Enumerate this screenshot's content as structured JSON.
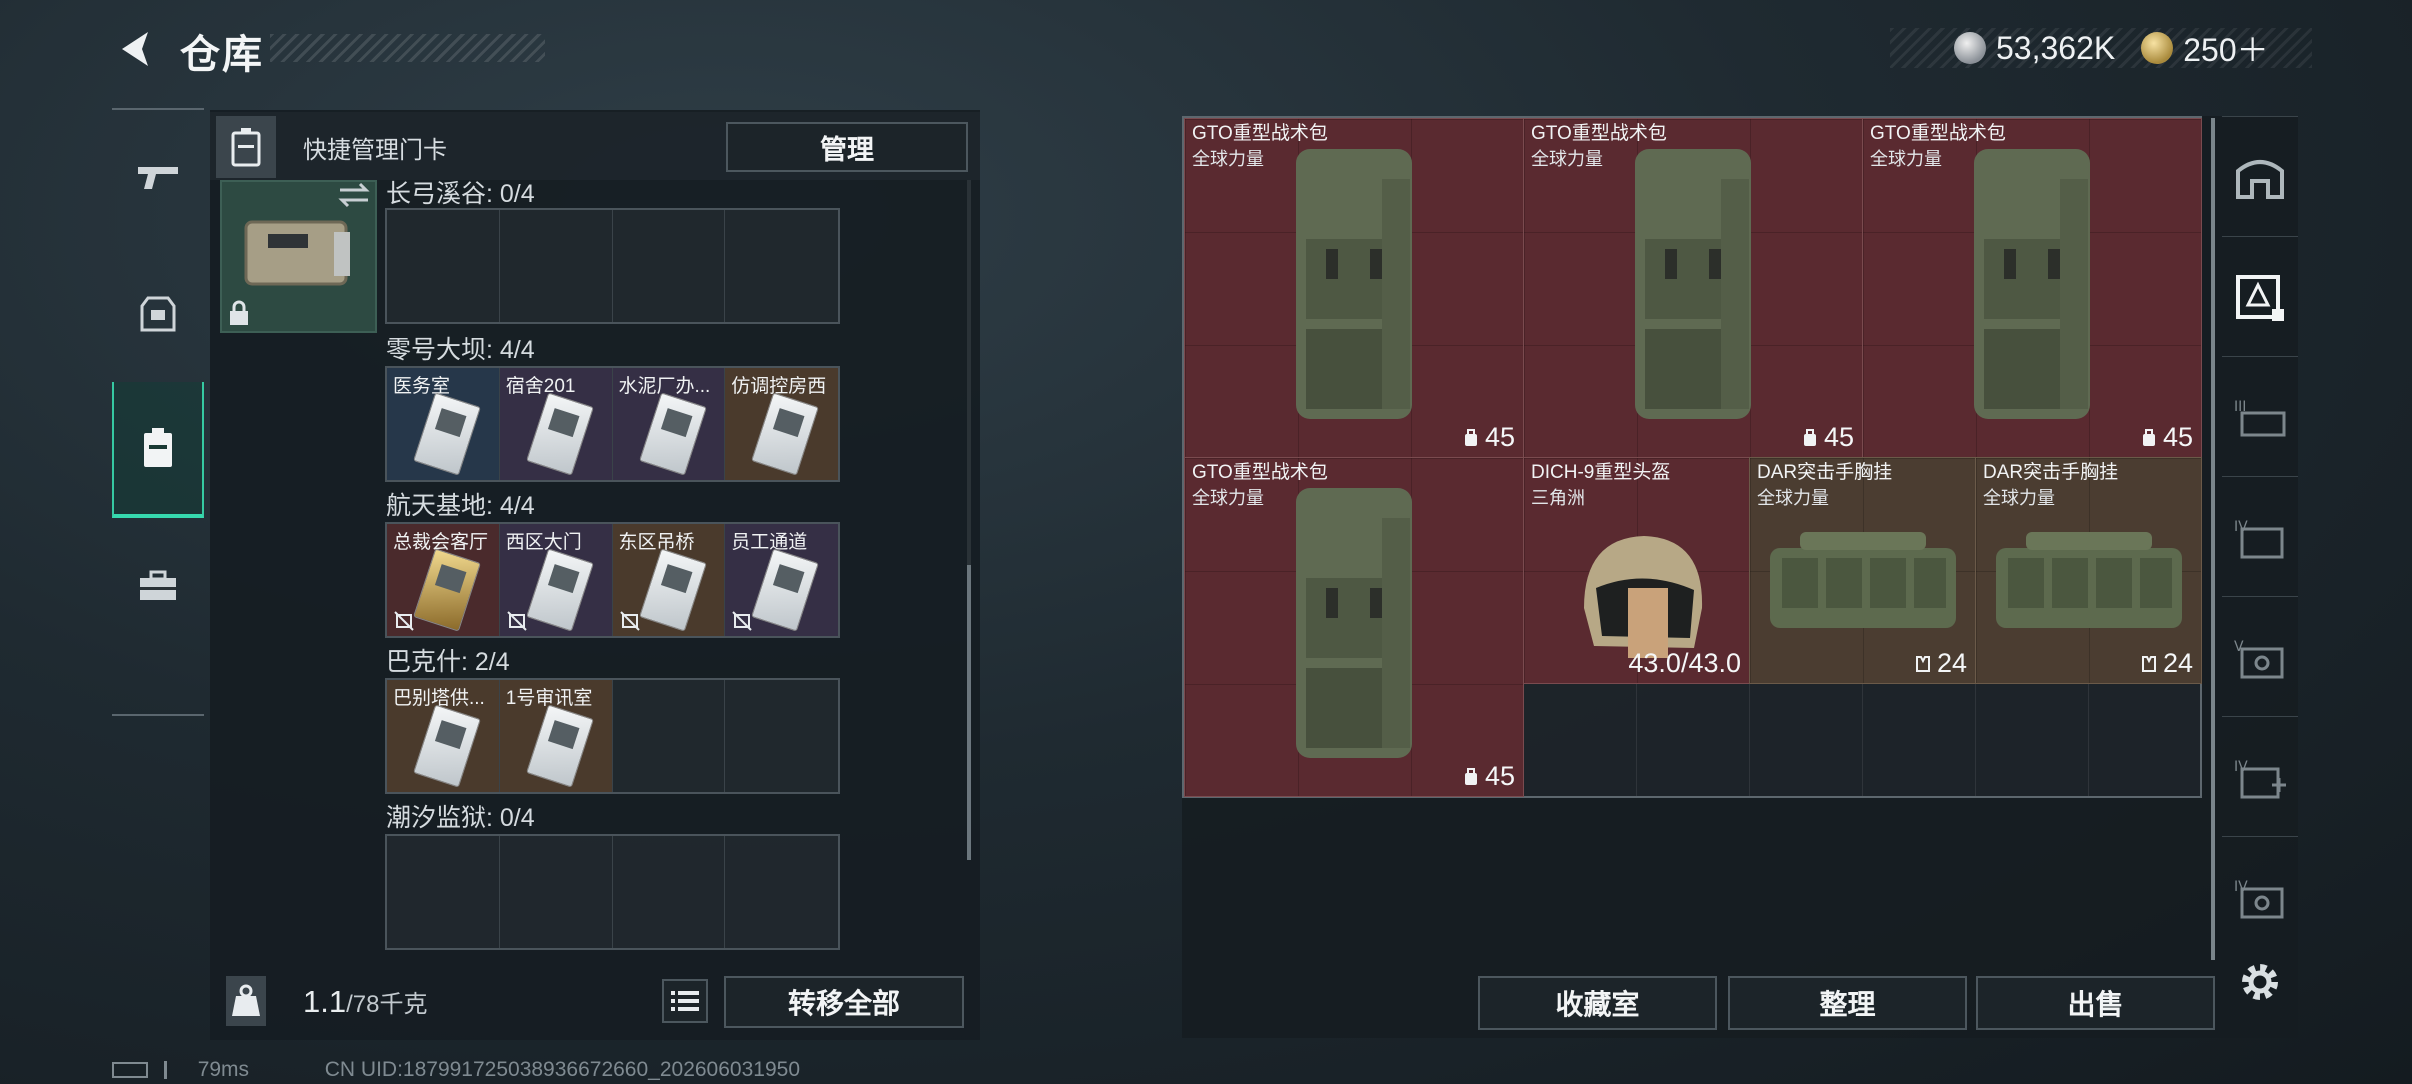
{
  "header": {
    "title": "仓库",
    "currency_silver": "53,362K",
    "currency_gold": "250＋"
  },
  "left_nav": {
    "items": [
      "pistol-icon",
      "armor-icon",
      "keycard-case-icon",
      "toolbox-icon"
    ],
    "active_index": 2
  },
  "keycard_panel": {
    "header_label": "快捷管理门卡",
    "manage_label": "管理",
    "regions": [
      {
        "label": "长弓溪谷: 0/4",
        "slots": []
      },
      {
        "label": "零号大坝: 4/4",
        "slots": [
          {
            "name": "医务室",
            "color": "#26374a"
          },
          {
            "name": "宿舍201",
            "color": "#352f45"
          },
          {
            "name": "水泥厂办...",
            "color": "#352f45"
          },
          {
            "name": "仿调控房西",
            "color": "#4a3a2c"
          }
        ]
      },
      {
        "label": "航天基地: 4/4",
        "slots": [
          {
            "name": "总裁会客厅",
            "color": "#4a2a2c",
            "gold": true
          },
          {
            "name": "西区大门",
            "color": "#352f45"
          },
          {
            "name": "东区吊桥",
            "color": "#4a3a2c"
          },
          {
            "name": "员工通道",
            "color": "#352f45"
          }
        ]
      },
      {
        "label": "巴克什: 2/4",
        "slots": [
          {
            "name": "巴别塔供...",
            "color": "#4a3a2c"
          },
          {
            "name": "1号审讯室",
            "color": "#4a3a2c"
          }
        ]
      },
      {
        "label": "潮汐监狱: 0/4",
        "slots": []
      }
    ],
    "weight_value": "1.1",
    "weight_unit": "/78千克",
    "transfer_all_label": "转移全部"
  },
  "inventory": {
    "items": [
      {
        "name": "GTO重型战术包",
        "sub": "全球力量",
        "count": "45",
        "kind": "backpack",
        "color": "red"
      },
      {
        "name": "GTO重型战术包",
        "sub": "全球力量",
        "count": "45",
        "kind": "backpack",
        "color": "red"
      },
      {
        "name": "GTO重型战术包",
        "sub": "全球力量",
        "count": "45",
        "kind": "backpack",
        "color": "red"
      },
      {
        "name": "GTO重型战术包",
        "sub": "全球力量",
        "count": "45",
        "kind": "backpack",
        "color": "red"
      },
      {
        "name": "DICH-9重型头盔",
        "sub": "三角洲",
        "count": "43.0/43.0",
        "kind": "helmet",
        "color": "red"
      },
      {
        "name": "DAR突击手胸挂",
        "sub": "全球力量",
        "count": "24",
        "kind": "rig",
        "color": "tan"
      },
      {
        "name": "DAR突击手胸挂",
        "sub": "全球力量",
        "count": "24",
        "kind": "rig",
        "color": "tan"
      }
    ],
    "buttons": {
      "collection": "收藏室",
      "sort": "整理",
      "sell": "出售"
    }
  },
  "right_nav": {
    "items": [
      "stash-icon",
      "container-tier-icon",
      "tier-3-icon",
      "tier-4-icon",
      "tier-5-icon",
      "tier-4-plus-icon",
      "tier-4-alt-icon"
    ]
  },
  "status": {
    "ping": "79ms",
    "uid": "CN UID:18799172503893667266​0_202606031950"
  }
}
